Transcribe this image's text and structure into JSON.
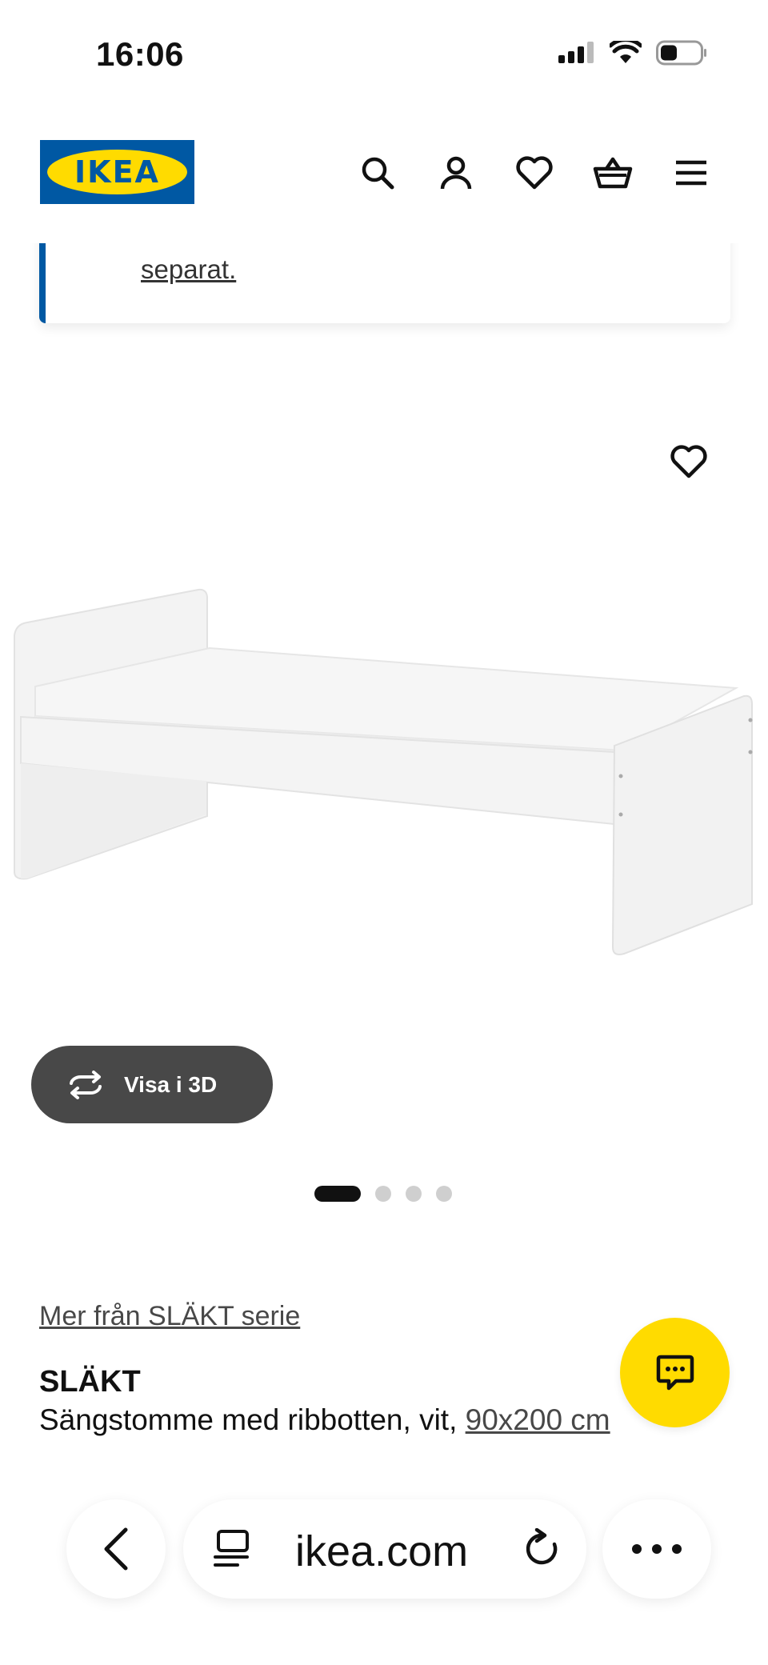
{
  "status_bar": {
    "time": "16:06"
  },
  "header": {
    "logo_text": "IKEA",
    "icons": [
      "search-icon",
      "account-icon",
      "heart-icon",
      "basket-icon",
      "menu-icon"
    ]
  },
  "banner": {
    "text": "separat."
  },
  "gallery": {
    "view_3d_label": "Visa i 3D",
    "page_count": 4,
    "active_page": 1
  },
  "product": {
    "series_link": "Mer från SLÄKT serie",
    "name": "SLÄKT",
    "description": "Sängstomme med ribbotten, vit, ",
    "size": "90x200 cm"
  },
  "browser": {
    "url": "ikea.com"
  },
  "colors": {
    "brand_blue": "#0058a3",
    "brand_yellow": "#ffdb00",
    "dark_button": "#484848"
  }
}
